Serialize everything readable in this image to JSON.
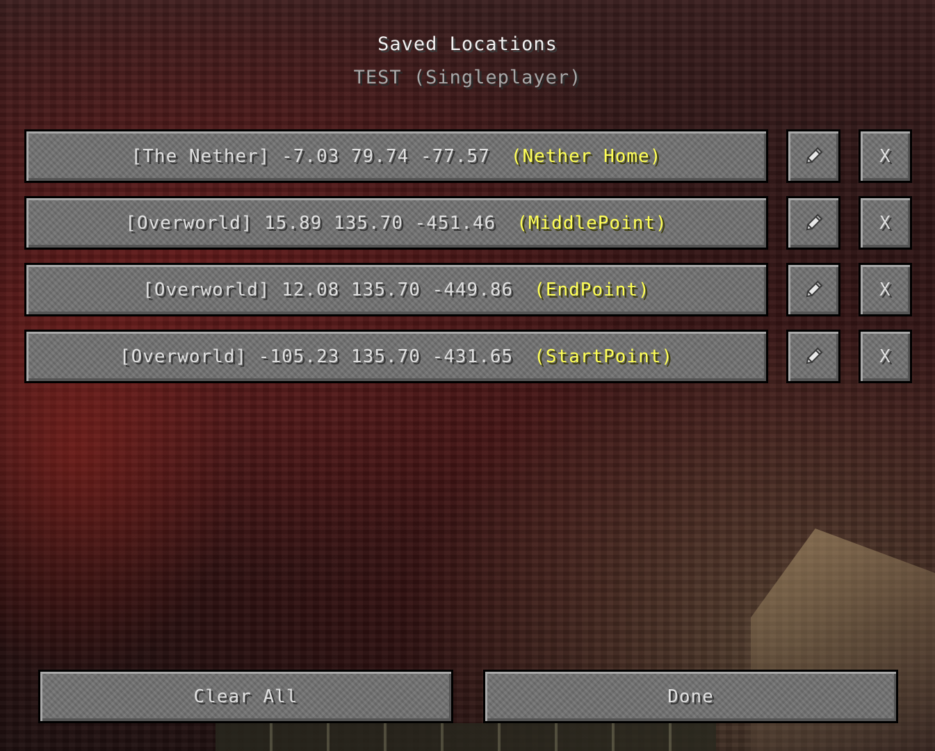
{
  "screen": {
    "title": "Saved Locations",
    "subtitle": "TEST (Singleplayer)"
  },
  "locations": [
    {
      "coords": "[The Nether] -7.03 79.74 -77.57",
      "name": "(Nether Home)",
      "edit_icon": "pencil-icon",
      "delete_label": "X"
    },
    {
      "coords": "[Overworld] 15.89 135.70 -451.46",
      "name": "(MiddlePoint)",
      "edit_icon": "pencil-icon",
      "delete_label": "X"
    },
    {
      "coords": "[Overworld] 12.08 135.70 -449.86",
      "name": "(EndPoint)",
      "edit_icon": "pencil-icon",
      "delete_label": "X"
    },
    {
      "coords": "[Overworld] -105.23 135.70 -431.65",
      "name": "(StartPoint)",
      "edit_icon": "pencil-icon",
      "delete_label": "X"
    }
  ],
  "actions": {
    "clear_all_label": "Clear All",
    "done_label": "Done"
  },
  "colors": {
    "location_name": "#ffff55",
    "button_text": "#e0e0e0",
    "button_face": "#707070",
    "title_text": "#f2f2f2",
    "subtitle_text": "#a8a8a8"
  }
}
